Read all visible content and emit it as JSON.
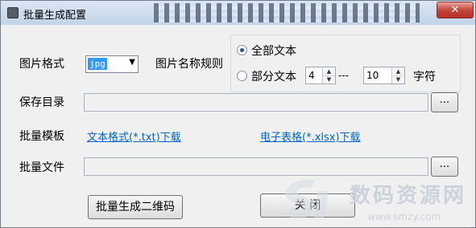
{
  "window": {
    "title": "批量生成配置",
    "close_glyph": "✕"
  },
  "row1": {
    "image_format_label": "图片格式",
    "image_format_value": "jpg",
    "name_rule_label": "图片名称规则",
    "all_text_label": "全部文本",
    "partial_text_label": "部分文本",
    "from_value": "4",
    "separator": "---",
    "to_value": "10",
    "unit_label": "字符",
    "selected_option": "全部文本"
  },
  "save_dir": {
    "label": "保存目录",
    "value": "",
    "browse_label": "..."
  },
  "template": {
    "label": "批量模板",
    "text_link": "文本格式(*.txt)下载",
    "excel_link": "电子表格(*.xlsx)下载"
  },
  "batch_file": {
    "label": "批量文件",
    "value": "",
    "browse_label": "..."
  },
  "buttons": {
    "generate_label": "批量生成二维码",
    "close_label": "关 闭"
  },
  "watermark": {
    "text": "数码资源网",
    "url": "www.smzy.com"
  },
  "colors": {
    "link": "#0066cc",
    "selection": "#3399ff",
    "close_button": "#c5453a"
  }
}
